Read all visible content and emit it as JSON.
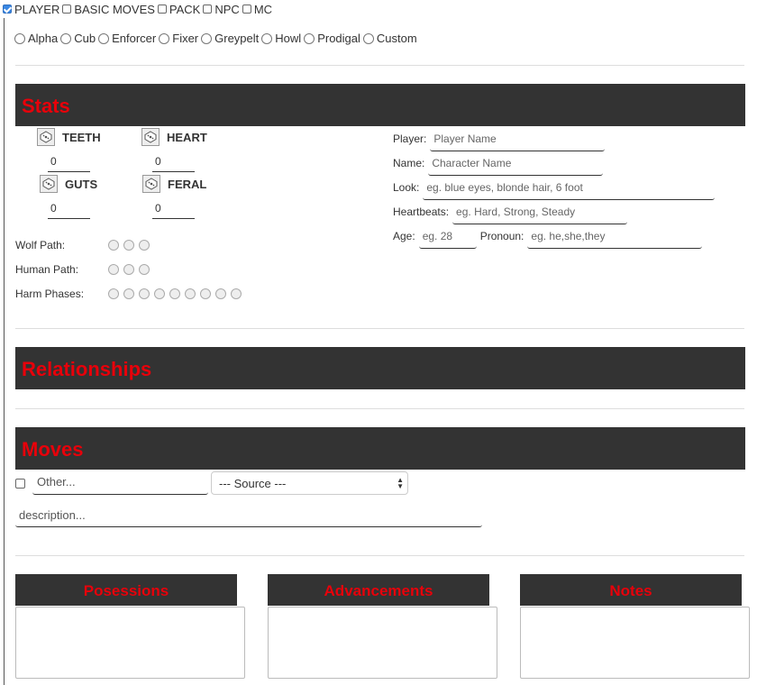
{
  "tabs": [
    {
      "label": "PLAYER",
      "checked": true
    },
    {
      "label": "BASIC MOVES",
      "checked": false
    },
    {
      "label": "PACK",
      "checked": false
    },
    {
      "label": "NPC",
      "checked": false
    },
    {
      "label": "MC",
      "checked": false
    }
  ],
  "playbooks": [
    "Alpha",
    "Cub",
    "Enforcer",
    "Fixer",
    "Greypelt",
    "Howl",
    "Prodigal",
    "Custom"
  ],
  "sections": {
    "stats": "Stats",
    "relationships": "Relationships",
    "moves": "Moves"
  },
  "stats": [
    {
      "name": "TEETH",
      "value": "0"
    },
    {
      "name": "HEART",
      "value": "0"
    },
    {
      "name": "GUTS",
      "value": "0"
    },
    {
      "name": "FERAL",
      "value": "0"
    }
  ],
  "tracks": {
    "wolf_path": {
      "label": "Wolf Path:",
      "count": 3
    },
    "human_path": {
      "label": "Human Path:",
      "count": 3
    },
    "harm_phases": {
      "label": "Harm Phases:",
      "count": 9
    }
  },
  "character": {
    "player": {
      "label": "Player:",
      "placeholder": "Player Name"
    },
    "name": {
      "label": "Name:",
      "placeholder": "Character Name"
    },
    "look": {
      "label": "Look:",
      "placeholder": "eg. blue eyes, blonde hair, 6 foot"
    },
    "heartbeats": {
      "label": "Heartbeats:",
      "placeholder": "eg. Hard, Strong, Steady"
    },
    "age": {
      "label": "Age:",
      "placeholder": "eg. 28"
    },
    "pronoun": {
      "label": "Pronoun:",
      "placeholder": "eg. he,she,they"
    }
  },
  "moves": {
    "other_placeholder": "Other...",
    "source_select": "--- Source ---",
    "description_placeholder": "description..."
  },
  "columns": [
    "Posessions",
    "Advancements",
    "Notes"
  ]
}
